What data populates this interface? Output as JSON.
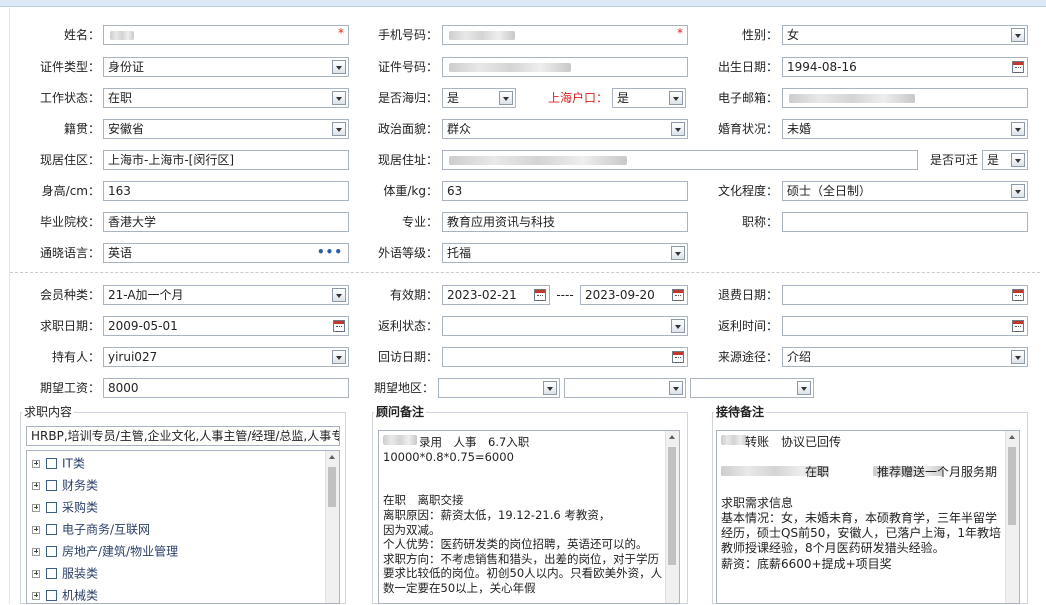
{
  "fields": {
    "name": {
      "label": "姓名：",
      "required_mark": "*"
    },
    "phone": {
      "label": "手机号码：",
      "required_mark": "*"
    },
    "gender": {
      "label": "性别：",
      "value": "女"
    },
    "id_type": {
      "label": "证件类型：",
      "value": "身份证"
    },
    "id_number": {
      "label": "证件号码："
    },
    "birth_date": {
      "label": "出生日期：",
      "value": "1994-08-16"
    },
    "work_status": {
      "label": "工作状态：",
      "value": "在职"
    },
    "returnee": {
      "label": "是否海归：",
      "value": "是"
    },
    "shanghai_hukou": {
      "label": "上海户口：",
      "value": "是"
    },
    "email": {
      "label": "电子邮箱："
    },
    "native_place": {
      "label": "籍贯：",
      "value": "安徽省"
    },
    "political": {
      "label": "政治面貌：",
      "value": "群众"
    },
    "marital": {
      "label": "婚育状况：",
      "value": "未婚"
    },
    "residence": {
      "label": "现居住区：",
      "value": "上海市-上海市-[闵行区]"
    },
    "address": {
      "label": "现居住址："
    },
    "transferable": {
      "label": "是否可迁",
      "value": "是"
    },
    "height": {
      "label": "身高/cm：",
      "value": "163"
    },
    "weight": {
      "label": "体重/kg：",
      "value": "63"
    },
    "education": {
      "label": "文化程度：",
      "value": "硕士（全日制）"
    },
    "school": {
      "label": "毕业院校：",
      "value": "香港大学"
    },
    "major": {
      "label": "专业：",
      "value": "教育应用资讯与科技"
    },
    "title": {
      "label": "职称："
    },
    "language": {
      "label": "通晓语言：",
      "value": "英语",
      "more": "•••"
    },
    "language_level": {
      "label": "外语等级：",
      "value": "托福"
    },
    "member_type": {
      "label": "会员种类：",
      "value": "21-A加一个月"
    },
    "valid_period": {
      "label": "有效期：",
      "start": "2023-02-21",
      "sep": "----",
      "end": "2023-09-20"
    },
    "refund_date": {
      "label": "退费日期："
    },
    "job_date": {
      "label": "求职日期：",
      "value": "2009-05-01"
    },
    "rebate_status": {
      "label": "返利状态："
    },
    "rebate_time": {
      "label": "返利时间："
    },
    "holder": {
      "label": "持有人：",
      "value": "yirui027"
    },
    "visit_date": {
      "label": "回访日期："
    },
    "source": {
      "label": "来源途径：",
      "value": "介绍"
    },
    "salary": {
      "label": "期望工资：",
      "value": "8000"
    },
    "region": {
      "label": "期望地区："
    }
  },
  "job_content": {
    "title": "求职内容",
    "summary": "HRBP,培训专员/主管,企业文化,人事主管/经理/总监,人事专",
    "tree": [
      "IT类",
      "财务类",
      "采购类",
      "电子商务/互联网",
      "房地产/建筑/物业管理",
      "服装类",
      "机械类"
    ]
  },
  "consultant_note": {
    "title": "顾问备注",
    "text": "录用　人事　6.7入职\n10000*0.8*0.75=6000\n\n\n在职　离职交接\n离职原因：薪资太低，19.12-21.6 考教资，\n因为双减。\n个人优势：医药研发类的岗位招聘，英语还可以的。\n求职方向：不考虑销售和猎头，出差的岗位，对于学历要求比较低的岗位。初创50人以内。只看欧美外资，人数一定要在50以上，关心年假"
  },
  "reception_note": {
    "title": "接待备注",
    "text": "　　转账　协议已回传\n\n　　　　　　　在职　　　　推荐赠送一个月服务期\n\n求职需求信息\n基本情况：女，未婚未育，本硕教育学，三年半留学经历，硕士QS前50，安徽人，已落户上海，1年教培教师授课经验，8个月医药研发猎头经验。\n薪资：底薪6600+提成+项目奖"
  }
}
